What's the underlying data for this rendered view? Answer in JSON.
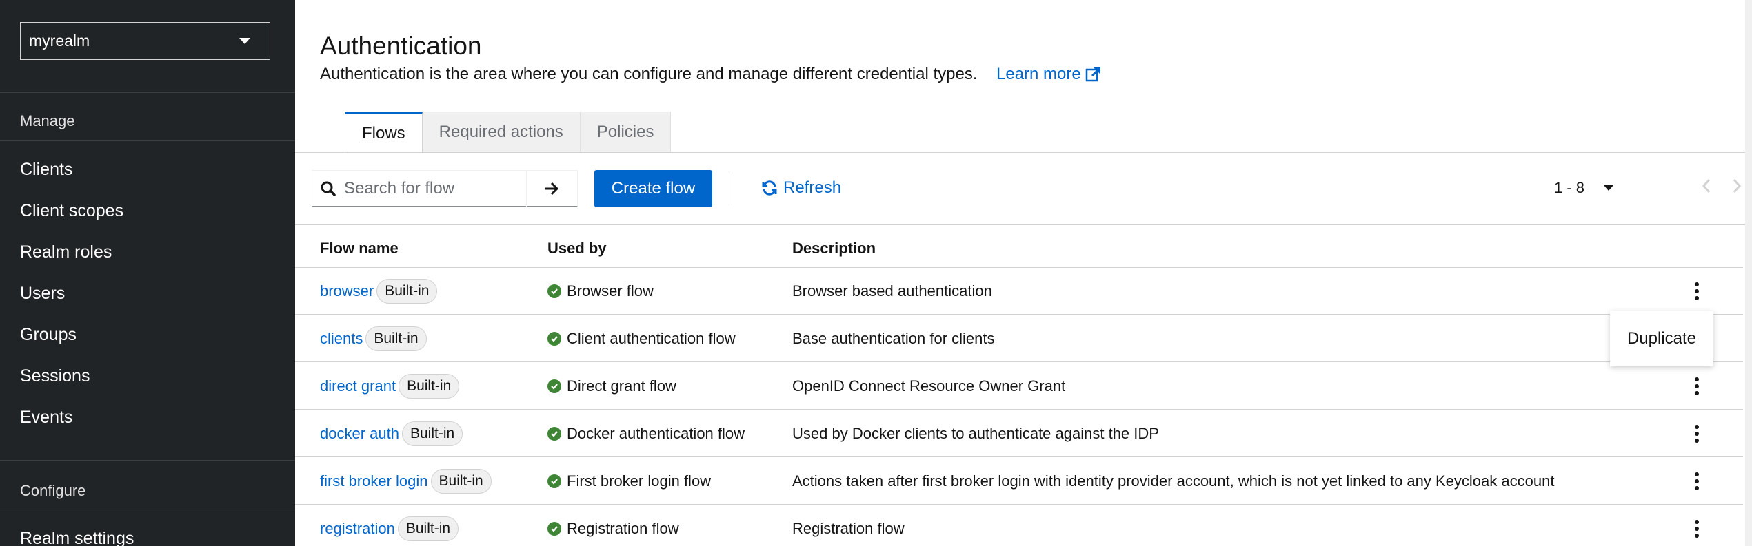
{
  "sidebar": {
    "realm": "myrealm",
    "manage_title": "Manage",
    "manage_items": [
      "Clients",
      "Client scopes",
      "Realm roles",
      "Users",
      "Groups",
      "Sessions",
      "Events"
    ],
    "configure_title": "Configure",
    "configure_items": [
      "Realm settings"
    ]
  },
  "page": {
    "title": "Authentication",
    "description": "Authentication is the area where you can configure and manage different credential types.",
    "learn_more": "Learn more"
  },
  "tabs": [
    {
      "label": "Flows",
      "active": true
    },
    {
      "label": "Required actions",
      "active": false
    },
    {
      "label": "Policies",
      "active": false
    }
  ],
  "toolbar": {
    "search_placeholder": "Search for flow",
    "create_label": "Create flow",
    "refresh_label": "Refresh",
    "pagination": "1 - 8"
  },
  "table": {
    "headers": {
      "name": "Flow name",
      "used_by": "Used by",
      "description": "Description"
    },
    "rows": [
      {
        "name": "browser",
        "badge": "Built-in",
        "used_by": "Browser flow",
        "description": "Browser based authentication"
      },
      {
        "name": "clients",
        "badge": "Built-in",
        "used_by": "Client authentication flow",
        "description": "Base authentication for clients"
      },
      {
        "name": "direct grant",
        "badge": "Built-in",
        "used_by": "Direct grant flow",
        "description": "OpenID Connect Resource Owner Grant"
      },
      {
        "name": "docker auth",
        "badge": "Built-in",
        "used_by": "Docker authentication flow",
        "description": "Used by Docker clients to authenticate against the IDP"
      },
      {
        "name": "first broker login",
        "badge": "Built-in",
        "used_by": "First broker login flow",
        "description": "Actions taken after first broker login with identity provider account, which is not yet linked to any Keycloak account"
      },
      {
        "name": "registration",
        "badge": "Built-in",
        "used_by": "Registration flow",
        "description": "Registration flow"
      }
    ]
  },
  "kebab_menu": {
    "item": "Duplicate"
  },
  "colors": {
    "accent": "#0066cc",
    "sidebar_bg": "#212427",
    "success": "#3e8635"
  }
}
